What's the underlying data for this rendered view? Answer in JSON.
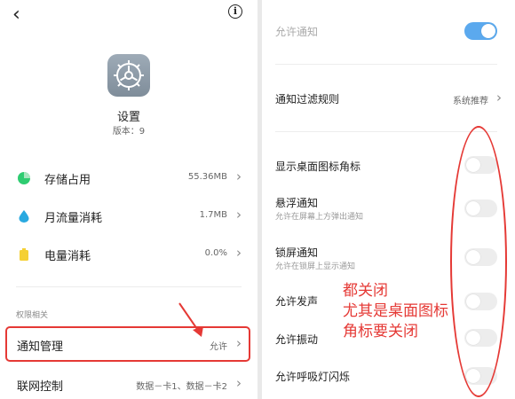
{
  "left": {
    "app_name": "设置",
    "app_version": "版本：9",
    "storage": {
      "label": "存储占用",
      "value": "55.36MB",
      "icon": "pie-chart-icon",
      "color": "#2ecc71"
    },
    "traffic": {
      "label": "月流量消耗",
      "value": "1.7MB",
      "icon": "water-drop-icon",
      "color": "#29a9e0"
    },
    "battery": {
      "label": "电量消耗",
      "value": "0.0%",
      "icon": "battery-icon",
      "color": "#f5d033"
    },
    "section_header": "权限相关",
    "notify_mgmt": {
      "label": "通知管理",
      "value": "允许"
    },
    "network": {
      "label": "联网控制",
      "value": "数据－卡1、数据－卡2"
    }
  },
  "right": {
    "allow_notify": {
      "label": "允许通知",
      "on": true
    },
    "filter_rule": {
      "label": "通知过滤规则",
      "value": "系统推荐"
    },
    "badge": {
      "label": "显示桌面图标角标",
      "on": false
    },
    "floating": {
      "label": "悬浮通知",
      "sub": "允许在屏幕上方弹出通知",
      "on": false
    },
    "lockscreen": {
      "label": "锁屏通知",
      "sub": "允许在锁屏上显示通知",
      "on": false
    },
    "sound": {
      "label": "允许发声",
      "on": false
    },
    "vibrate": {
      "label": "允许振动",
      "on": false
    },
    "led": {
      "label": "允许呼吸灯闪烁",
      "on": false
    }
  },
  "annotation": {
    "lines": [
      "都关闭",
      "尤其是桌面图标",
      "角标要关闭"
    ],
    "color": "#e53935"
  },
  "colors": {
    "accent": "#5ba9ee",
    "annotation": "#e53935"
  }
}
